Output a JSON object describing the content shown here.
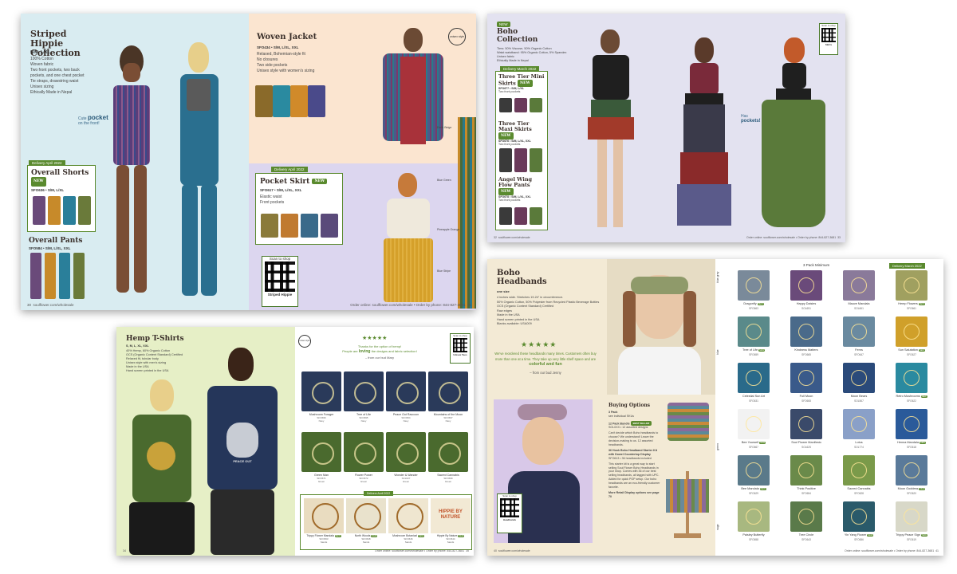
{
  "spread1": {
    "left": {
      "title": "Striped Hippie Collection",
      "sizes": "S/M, L/XL",
      "bullets": [
        "100% Cotton",
        "Woven fabric",
        "Two front pockets, two back pockets, and one chest pocket",
        "Tie straps, drawstring waist",
        "Unisex sizing",
        "Ethically Made in Nepal"
      ],
      "callout_pre": "Cute",
      "callout_word": "pocket",
      "callout_post": "on the front!",
      "delivery": "Delivery April 2022",
      "shorts_title": "Overall Shorts",
      "shorts_badge": "NEW",
      "shorts_sku": "SFO636 • S/M, L/XL",
      "pants_title": "Overall Pants",
      "pants_sku": "SFO584 • S/M, L/XL, XXL",
      "page_num": "30",
      "footer": "soulflower.com/wholesale"
    },
    "right": {
      "jacket_title": "Woven Jacket",
      "jacket_sku": "SFO434 • S/M, L/XL, XXL",
      "jacket_bullets": [
        "Relaxed, Bohemian-style fit",
        "No closures",
        "Two side pockets",
        "Unisex style with women's sizing"
      ],
      "skirt_delivery": "Delivery April 2022",
      "skirt_title": "Pocket Skirt",
      "skirt_badge": "NEW",
      "skirt_sku": "SFO617 • S/M, L/XL, XXL",
      "skirt_bullets": [
        "Elastic waist",
        "Front pockets"
      ],
      "qr_label": "Scan to shop",
      "qr_caption": "Striped Hippie",
      "side_labels": [
        "Earth Beige",
        "Blue Green",
        "Pineapple Orange",
        "Blue Stripe"
      ],
      "logo": "unisex style",
      "page_num": "31",
      "footer": "Order online: soulflower.com/wholesale • Order by phone: 844-827-3681"
    }
  },
  "spread2": {
    "left": {
      "badge": "NEW",
      "title": "Boho Collection",
      "bullets": [
        "Tiers: 50% Viscose, 50% Organic Cotton",
        "Waist waistband: 95% Organic Cotton, 5% Spandex",
        "Unisex fabric",
        "Ethically Made in Nepal"
      ],
      "delivery": "Delivery March 2022",
      "items": [
        {
          "title": "Three Tier Mini Skirts",
          "badge": "NEW",
          "sku": "SFO677 • S/M, L/XL",
          "note": "Two front pockets",
          "swatches": [
            "Black",
            "Purple",
            "Green"
          ]
        },
        {
          "title": "Three Tier Maxi Skirts",
          "badge": "NEW",
          "sku": "SFO676 • S/M, L/XL, XXL",
          "note": "Two front pockets",
          "swatches": [
            "Black",
            "Purple",
            "Green"
          ]
        },
        {
          "title": "Angel Wing Flow Pants",
          "badge": "NEW",
          "sku": "SFO678 • S/M, L/XL, XXL",
          "note": "Two front pockets",
          "swatches": [
            "Black",
            "Purple",
            "Green"
          ]
        }
      ],
      "page_num": "32",
      "footer": "soulflower.com/wholesale"
    },
    "right": {
      "qr_label": "Scan to shop",
      "qr_caption": "Skirts",
      "callout_pre": "Has",
      "callout_word": "pockets!",
      "page_num": "33",
      "footer": "Order online: soulflower.com/wholesale • Order by phone: 844-827-3681"
    }
  },
  "spread3": {
    "left": {
      "title": "Hemp T-Shirts",
      "sizes": "S, M, L, XL, XXL",
      "bullets": [
        "40% Hemp, 60% Organic Cotton",
        "OCS (Organic Content Standard) Certified",
        "Relaxed fit, tubular body",
        "Unisex style with men's sizing",
        "Made in the USA",
        "Hand screen printed in the USA"
      ],
      "page_num": "34",
      "footer": "Order online: soulflower.com/wholesale • Order by phone: 844-827-3681"
    },
    "right": {
      "stars": "★★★★★",
      "quote1": "Thanks for the option of hemp!",
      "quote2_pre": "People are",
      "quote2_word": "loving",
      "quote2_post": "the designs and fabric selection!",
      "quote_by": "– from our bud Mary",
      "qr_label": "Scan to shop",
      "qr_caption": "Unisex Tees",
      "logo": "unisex style",
      "tees": [
        {
          "name": "Mushroom Forager",
          "sku": "SFO696",
          "color": "Navy"
        },
        {
          "name": "Tree of Life",
          "sku": "SFO695",
          "color": "Navy"
        },
        {
          "name": "Peace Out Raccoon",
          "sku": "SFO664",
          "color": "Navy"
        },
        {
          "name": "Mountains of the Moon",
          "sku": "SFO697",
          "color": "Navy"
        },
        {
          "name": "Green Man",
          "sku": "SFO671",
          "color": "Green"
        },
        {
          "name": "Flower Power",
          "sku": "SFO672",
          "color": "Green"
        },
        {
          "name": "Wonder & Wander",
          "sku": "SCL627",
          "color": "Green"
        },
        {
          "name": "Sacred Cannabis",
          "sku": "SFO699",
          "color": "Green"
        }
      ],
      "delivery": "Delivery April 2022",
      "new_tees": [
        {
          "name": "Trippy Flower Mandala",
          "badge": "NEW",
          "sku": "SFO663",
          "color": "Sands"
        },
        {
          "name": "North Woods",
          "badge": "NEW",
          "sku": "SFO648",
          "color": "Sands"
        },
        {
          "name": "Mushroom Botanical",
          "badge": "NEW",
          "sku": "SFO646",
          "color": "Sands"
        },
        {
          "name": "Hippie By Nature",
          "badge": "NEW",
          "sku": "SFO644",
          "color": "Sands"
        }
      ],
      "hippie_art": "HIPPIE BY NATURE",
      "tee_art": "PEACE OUT",
      "page_num": "35"
    }
  },
  "spread4": {
    "left": {
      "title": "Boho Headbands",
      "sizes": "one size",
      "bullets": [
        "4 inches wide. Stretches 19-24\" in circumference.",
        "50% Organic Cotton, 50% Polyester from Recycled Plastic Beverage Bottles",
        "OCS (Organic Content Standard) Certified",
        "Raw edges",
        "Made in the USA",
        "Hand screen printed in the USA",
        "Blanks available: USA009"
      ],
      "stars": "★★★★★",
      "quote": "We've reordered these headbands many times. Customers often buy more than one at a time. They take up very little shelf space and are",
      "quote_emph": "colorful and fun",
      "quote_by": "– from our bud Jenny",
      "qr_label": "Scan to shop",
      "qr_caption": "Headbands",
      "buying_title": "Buying Options",
      "opt1_title": "3 Pack",
      "opt1_text": "see individual SKUs",
      "opt2_title": "12 Pack Bundle",
      "opt2_badge": "BEST SELLER",
      "opt2_text": "SOL0XX • 12 assorted designs",
      "opt2_body": "Can't decide which Boho headbands to choose? We understand! Leave the decision-making to us. 12 assorted headbands.",
      "opt3_title": "36 Hook Boho Headband Starter Kit with Dowel Countertop Display",
      "opt3_sku": "SFO613 • 36 headbands included",
      "opt3_body": "This starter kit is a great way to start selling Soul Flower Boho Headbands in your shop. Comes with 36 of our best selling headbands, all tagged with UPC. Added for quick POP setup. Our boho headbands are an eco-friendly customer favorite.",
      "opt_more": "More Retail Display options see page 70",
      "page_num": "40",
      "footer": "soulflower.com/wholesale"
    },
    "right": {
      "min_note": "3 Pack Minimum",
      "delivery": "Delivery March 2022",
      "side_labels": [
        "blue grey",
        "blue",
        "green",
        "sage"
      ],
      "grid": [
        [
          {
            "name": "Dragonfly",
            "sku": "SFO663",
            "badge": "NEW"
          },
          {
            "name": "Happy Daisies",
            "sku": "SOL651"
          },
          {
            "name": "Mauve Mandala",
            "sku": "SOL661"
          },
          {
            "name": "Hemp Flowers",
            "sku": "SFO661",
            "badge": "NEW"
          }
        ],
        [
          {
            "name": "Tree of Life",
            "sku": "SFO659",
            "badge": "NEW"
          },
          {
            "name": "Kindness Matters",
            "sku": "SFO665"
          },
          {
            "name": "Ferns",
            "sku": "SFO647"
          },
          {
            "name": "Sun Salutation",
            "sku": "SFO627",
            "badge": "NEW"
          }
        ],
        [
          {
            "name": "Celestial Sun Art",
            "sku": "SFO631"
          },
          {
            "name": "Full Moon",
            "sku": "SFO608"
          },
          {
            "name": "Moon Bears",
            "sku": "SOL567"
          },
          {
            "name": "Retro Mushrooms",
            "sku": "SFO622",
            "badge": "NEW"
          }
        ],
        [
          {
            "name": "Bee Yourself",
            "sku": "SFO667",
            "badge": "NEW"
          },
          {
            "name": "Soul Flower Manifesto",
            "sku": "SOL625"
          },
          {
            "name": "Lotus",
            "sku": "SOL774"
          },
          {
            "name": "Henna Mandala",
            "sku": "SFO618",
            "badge": "NEW"
          }
        ],
        [
          {
            "name": "Bee Mandala",
            "sku": "SFO629",
            "badge": "NEW"
          },
          {
            "name": "Think Positive",
            "sku": "SFO654"
          },
          {
            "name": "Sacred Cannabis",
            "sku": "SFO628"
          },
          {
            "name": "Moon Goddess",
            "sku": "SFO620",
            "badge": "NEW"
          }
        ],
        [
          {
            "name": "Paisley Butterfly",
            "sku": "SFO658"
          },
          {
            "name": "Tree Circle",
            "sku": "SFO643"
          },
          {
            "name": "Yin Yang Flower",
            "sku": "SFO656",
            "badge": "NEW"
          },
          {
            "name": "Trippy Peace Sign",
            "sku": "SFO619",
            "badge": "NEW"
          }
        ]
      ],
      "page_num": "41",
      "footer": "Order online: soulflower.com/wholesale • Order by phone: 844-827-3681"
    }
  }
}
